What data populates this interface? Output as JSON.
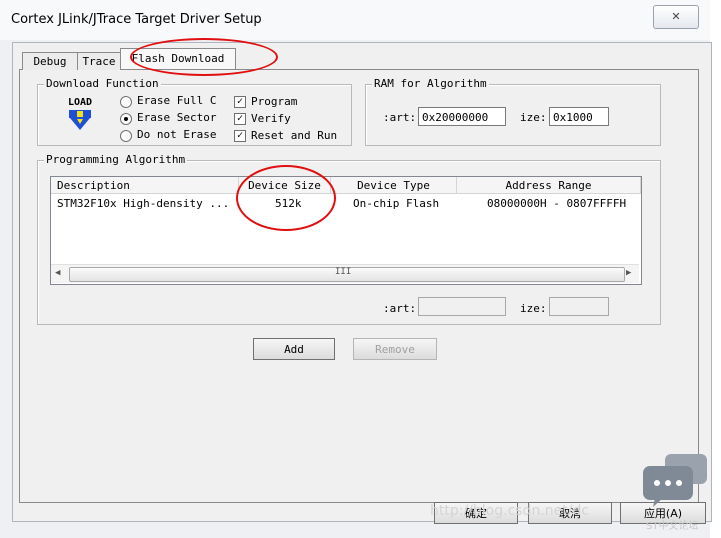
{
  "window": {
    "title": "Cortex JLink/JTrace Target Driver Setup",
    "close_label": "✕"
  },
  "tabs": [
    {
      "label": "Debug"
    },
    {
      "label": "Trace"
    },
    {
      "label": "Flash Download",
      "selected": true
    }
  ],
  "download_function": {
    "group_title": "Download Function",
    "icon_text": "LOAD",
    "options": [
      {
        "label": "Erase Full C",
        "selected": false
      },
      {
        "label": "Erase Sector",
        "selected": true
      },
      {
        "label": "Do not Erase",
        "selected": false
      }
    ],
    "checks": [
      {
        "label": "Program",
        "checked": true
      },
      {
        "label": "Verify",
        "checked": true
      },
      {
        "label": "Reset and Run",
        "checked": true
      }
    ]
  },
  "ram": {
    "group_title": "RAM for Algorithm",
    "start_label": ":art:",
    "start_value": "0x20000000",
    "size_label": "ize:",
    "size_value": "0x1000"
  },
  "algorithm": {
    "group_title": "Programming Algorithm",
    "columns": [
      "Description",
      "Device Size",
      "Device Type",
      "Address Range"
    ],
    "rows": [
      {
        "description": "STM32F10x High-density ...",
        "size": "512k",
        "type": "On-chip Flash",
        "range": "08000000H - 0807FFFFH"
      }
    ],
    "scroll_mark": "III",
    "start_label": ":art:",
    "start_value": "",
    "size_label": "ize:",
    "size_value": ""
  },
  "buttons": {
    "add": "Add",
    "remove": "Remove",
    "ok": "确定",
    "cancel": "取消",
    "apply": "应用(A)"
  },
  "overlay": {
    "watermark": "http://blog.csdn.net/dc",
    "badge": "ST中文论坛"
  },
  "colors": {
    "annotation": "#e01010",
    "icon_blue": "#1f4fd6",
    "icon_yellow": "#f2e21a"
  }
}
